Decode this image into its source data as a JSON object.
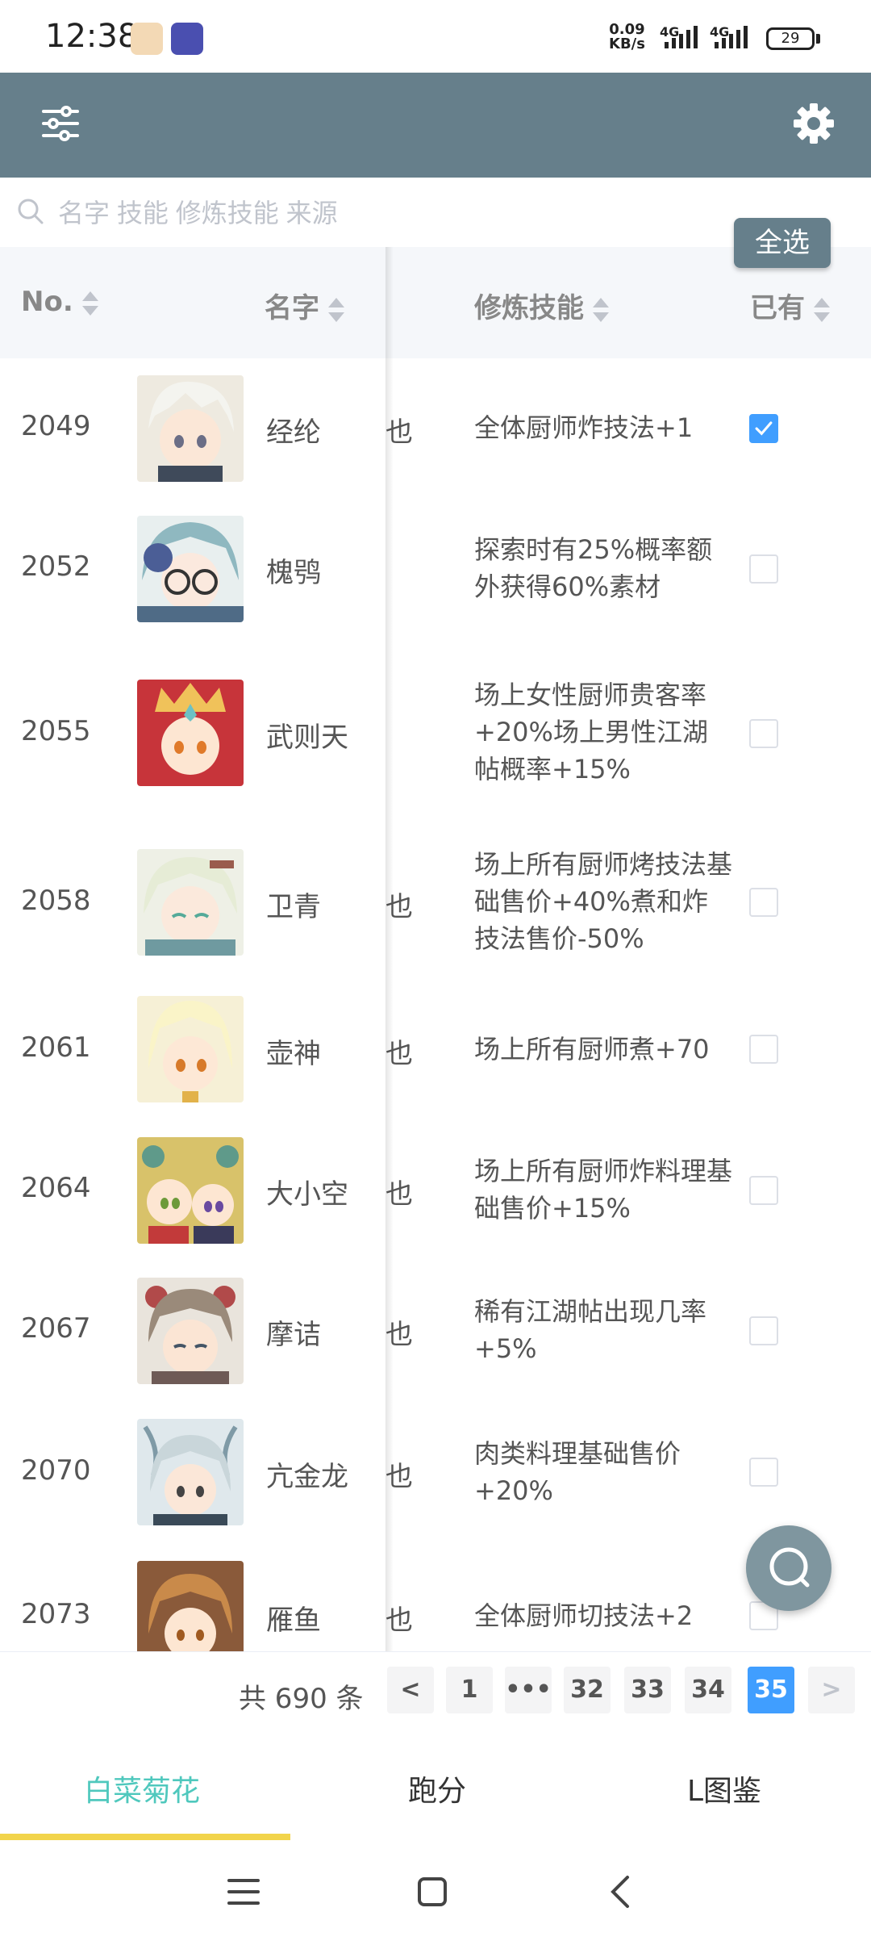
{
  "status": {
    "time": "12:38",
    "net_speed_value": "0.09",
    "net_speed_unit": "KB/s",
    "net1": "4G",
    "net2": "4G",
    "battery": "29"
  },
  "search": {
    "placeholder": "名字 技能 修炼技能 来源"
  },
  "select_all_label": "全选",
  "table": {
    "headers": {
      "no": "No.",
      "name": "名字",
      "skill": "修炼技能",
      "owned": "已有"
    },
    "rows": [
      {
        "no": "2049",
        "name": "经纶",
        "frag": "也",
        "skill": "全体厨师炸技法+1",
        "checked": true
      },
      {
        "no": "2052",
        "name": "槐鸮",
        "frag": "",
        "skill": "探索时有25%概率额外获得60%素材",
        "checked": false
      },
      {
        "no": "2055",
        "name": "武则天",
        "frag": "",
        "skill": "场上女性厨师贵客率+20%场上男性江湖帖概率+15%",
        "checked": false
      },
      {
        "no": "2058",
        "name": "卫青",
        "frag": "也",
        "skill": "场上所有厨师烤技法基础售价+40%煮和炸技法售价-50%",
        "checked": false
      },
      {
        "no": "2061",
        "name": "壶神",
        "frag": "也",
        "skill": "场上所有厨师煮+70",
        "checked": false
      },
      {
        "no": "2064",
        "name": "大小空",
        "frag": "也",
        "skill": "场上所有厨师炸料理基础售价+15%",
        "checked": false
      },
      {
        "no": "2067",
        "name": "摩诘",
        "frag": "也",
        "skill": "稀有江湖帖出现几率+5%",
        "checked": false
      },
      {
        "no": "2070",
        "name": "亢金龙",
        "frag": "也",
        "skill": "肉类料理基础售价+20%",
        "checked": false
      },
      {
        "no": "2073",
        "name": "雁鱼",
        "frag": "也",
        "skill": "全体厨师切技法+2",
        "checked": false
      }
    ]
  },
  "pagination": {
    "total": "共 690 条",
    "prev": "<",
    "next": ">",
    "pages": [
      "1",
      "•••",
      "32",
      "33",
      "34",
      "35"
    ],
    "current": "35"
  },
  "tabs": [
    "白菜菊花",
    "跑分",
    "L图鉴"
  ],
  "colors": {
    "header_bar": "#667f8b",
    "accent_blue": "#409eff",
    "tab_active": "#4fc8bd",
    "tab_underline": "#f2d44b"
  }
}
